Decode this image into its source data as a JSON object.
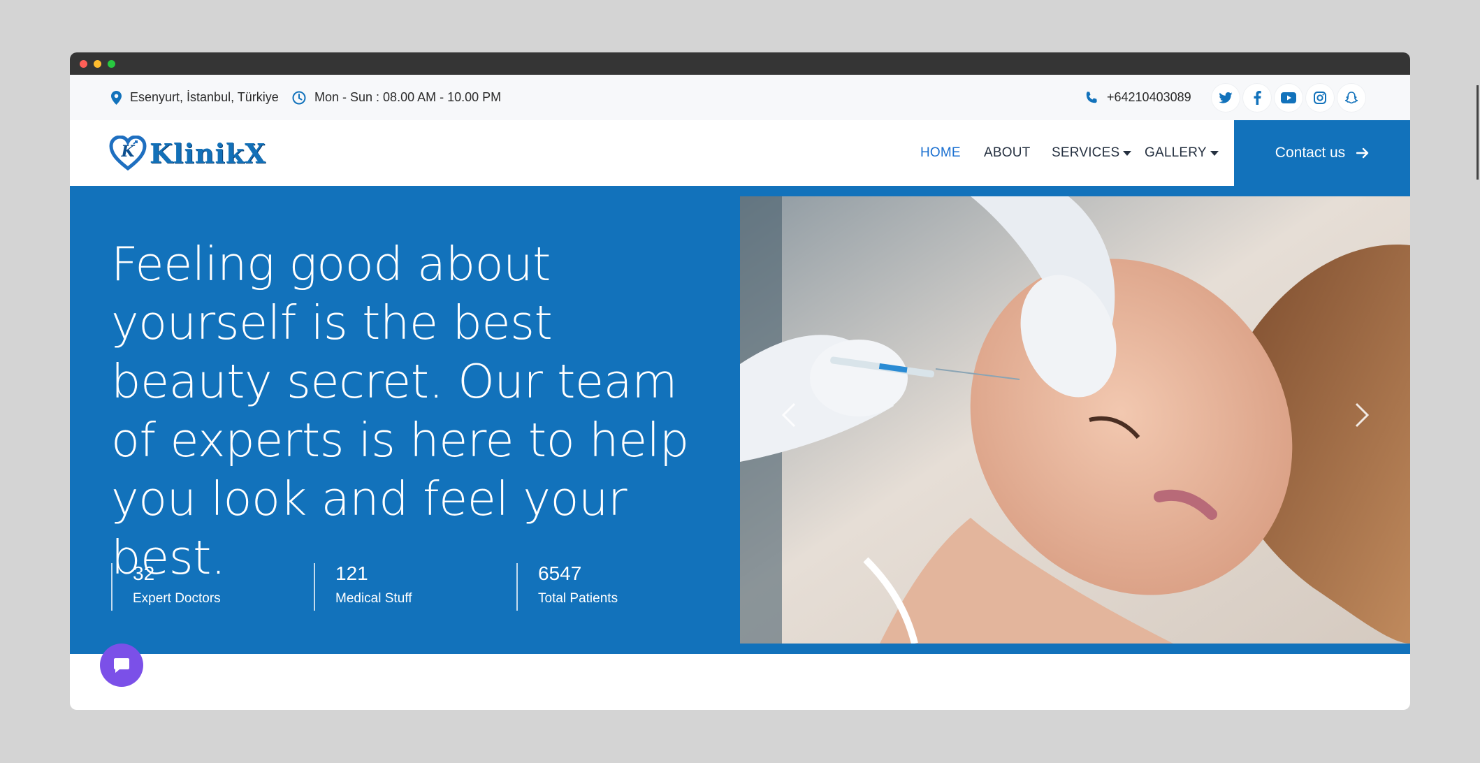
{
  "topbar": {
    "location": "Esenyurt, İstanbul, Türkiye",
    "hours": "Mon - Sun : 08.00 AM - 10.00 PM",
    "phone": "+64210403089"
  },
  "social_icons": [
    "twitter-icon",
    "facebook-icon",
    "youtube-icon",
    "instagram-icon",
    "snapchat-icon"
  ],
  "brand": {
    "name": "KlinikX"
  },
  "nav": {
    "items": [
      {
        "label": "HOME",
        "active": true
      },
      {
        "label": "ABOUT"
      },
      {
        "label": "SERVICES",
        "dropdown": true
      },
      {
        "label": "GALLERY",
        "dropdown": true
      }
    ],
    "cta": "Contact us"
  },
  "hero": {
    "headline": "Feeling good about yourself is the best beauty secret. Our team of experts is here to help you look and feel your best.",
    "stats": [
      {
        "value": "32",
        "label": "Expert Doctors"
      },
      {
        "value": "121",
        "label": "Medical Stuff"
      },
      {
        "value": "6547",
        "label": "Total Patients"
      }
    ]
  },
  "colors": {
    "primary": "#1272bb",
    "nav_active": "#1a6fd0",
    "chat": "#7b50e8",
    "topbar_bg": "#f7f8fa"
  }
}
